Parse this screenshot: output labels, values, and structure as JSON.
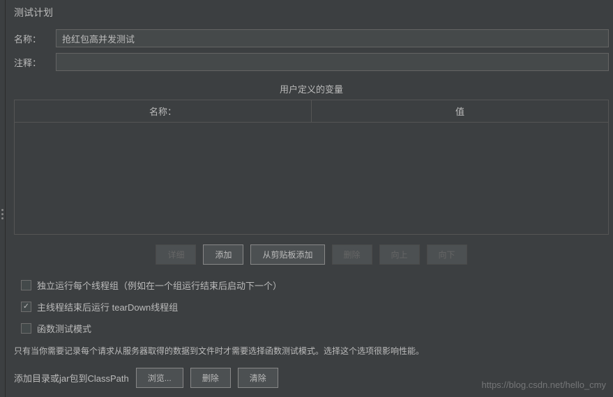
{
  "header": {
    "title": "测试计划"
  },
  "fields": {
    "name_label": "名称：",
    "name_value": "抢红包高并发测试",
    "comment_label": "注释：",
    "comment_value": ""
  },
  "variables": {
    "section_title": "用户定义的变量",
    "col_name": "名称：",
    "col_value": "值"
  },
  "buttons": {
    "detail": "详细",
    "add": "添加",
    "add_from_clipboard": "从剪贴板添加",
    "delete": "删除",
    "up": "向上",
    "down": "向下"
  },
  "checkboxes": {
    "independent": {
      "label": "独立运行每个线程组（例如在一个组运行结束后启动下一个）",
      "checked": false
    },
    "teardown": {
      "label": "主线程结束后运行 tearDown线程组",
      "checked": true
    },
    "functional": {
      "label": "函数测试模式",
      "checked": false
    }
  },
  "info": "只有当你需要记录每个请求从服务器取得的数据到文件时才需要选择函数测试模式。选择这个选项很影响性能。",
  "classpath": {
    "label": "添加目录或jar包到ClassPath",
    "browse": "浏览...",
    "delete": "删除",
    "clear": "清除"
  },
  "watermark": "https://blog.csdn.net/hello_cmy"
}
